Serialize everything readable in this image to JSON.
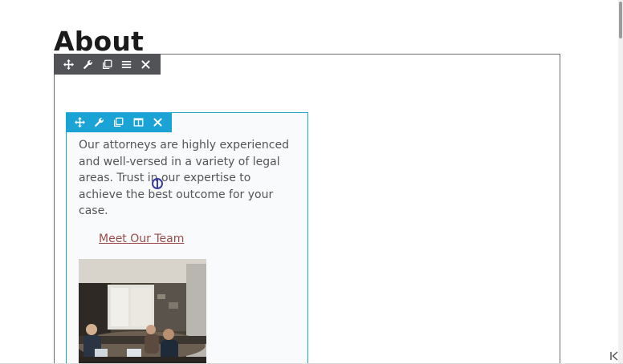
{
  "page": {
    "title": "About"
  },
  "module": {
    "body_text": "Our attorneys are highly experienced and well-versed in a variety of legal areas. Trust in our expertise to achieve the best outcome for your case.",
    "link_text": "Meet Our Team"
  },
  "row_toolbar": {
    "icons": [
      "move-icon",
      "wrench-icon",
      "duplicate-icon",
      "menu-icon",
      "close-icon"
    ]
  },
  "module_toolbar": {
    "icons": [
      "move-icon",
      "wrench-icon",
      "duplicate-icon",
      "columns-icon",
      "close-icon"
    ]
  },
  "colors": {
    "row_toolbar_bg": "#515357",
    "module_toolbar_bg": "#1ba3d6",
    "module_outline": "#21a0c6",
    "link": "#9a4b4b",
    "body_text": "#555555"
  }
}
